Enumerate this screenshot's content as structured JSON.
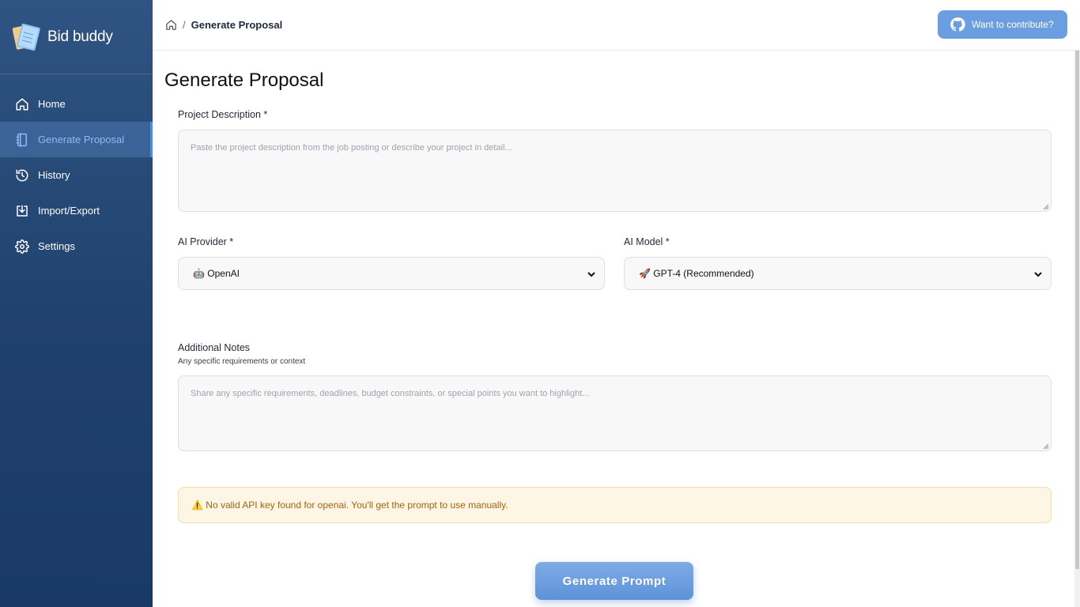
{
  "app": {
    "name": "Bid buddy"
  },
  "colors": {
    "accent": "#4a90e2",
    "sidebar": "#1f416c",
    "warning_bg": "#fef6e4",
    "warning_text": "#a56412"
  },
  "sidebar": {
    "items": [
      {
        "label": "Home",
        "icon": "home-icon",
        "active": false
      },
      {
        "label": "Generate Proposal",
        "icon": "notebook-icon",
        "active": true
      },
      {
        "label": "History",
        "icon": "history-icon",
        "active": false
      },
      {
        "label": "Import/Export",
        "icon": "import-export-icon",
        "active": false
      },
      {
        "label": "Settings",
        "icon": "gear-icon",
        "active": false
      }
    ]
  },
  "header": {
    "breadcrumb_sep": "/",
    "breadcrumb_current": "Generate Proposal",
    "contribute_label": "Want to contribute?"
  },
  "main": {
    "title": "Generate Proposal",
    "project_description": {
      "label": "Project Description *",
      "placeholder": "Paste the project description from the job posting or describe your project in detail..."
    },
    "ai_provider": {
      "label": "AI Provider *",
      "value": "🤖 OpenAI"
    },
    "ai_model": {
      "label": "AI Model *",
      "value": "🚀 GPT-4 (Recommended)"
    },
    "additional_notes": {
      "label": "Additional Notes",
      "hint": "Any specific requirements or context",
      "placeholder": "Share any specific requirements, deadlines, budget constraints, or special points you want to highlight..."
    },
    "warning": "⚠️ No valid API key found for openai. You'll get the prompt to use manually.",
    "generate_button": "Generate Prompt"
  }
}
